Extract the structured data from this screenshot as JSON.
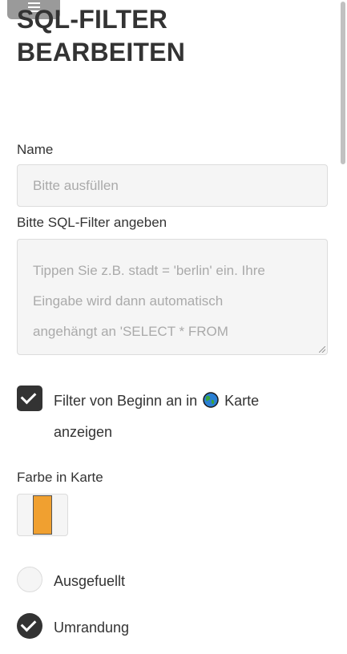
{
  "page": {
    "title_line1": "SQL-FILTER",
    "title_line2": "BEARBEITEN"
  },
  "menu": {
    "icon": "hamburger-menu-icon"
  },
  "form": {
    "name_label": "Name",
    "name_placeholder": "Bitte ausfüllen",
    "sql_label": "Bitte SQL-Filter angeben",
    "sql_placeholder_lines": [
      "Tippen Sie z.B. stadt = 'berlin' ein. Ihre",
      "Eingabe wird dann automatisch",
      "angehängt an 'SELECT * FROM"
    ],
    "show_on_start": {
      "checked": true,
      "text_before_icon": "Filter von Beginn an in",
      "icon": "globe-icon",
      "text_after_icon": "Karte",
      "text_line2": "anzeigen"
    },
    "color_label": "Farbe in Karte",
    "color_value": "#f0a030",
    "style_options": [
      {
        "label": "Ausgefuellt",
        "checked": false
      },
      {
        "label": "Umrandung",
        "checked": true
      }
    ]
  },
  "colors": {
    "text": "#333333",
    "placeholder": "#aaaaaa",
    "field_bg": "#f5f5f5",
    "accent_dark": "#333333"
  }
}
